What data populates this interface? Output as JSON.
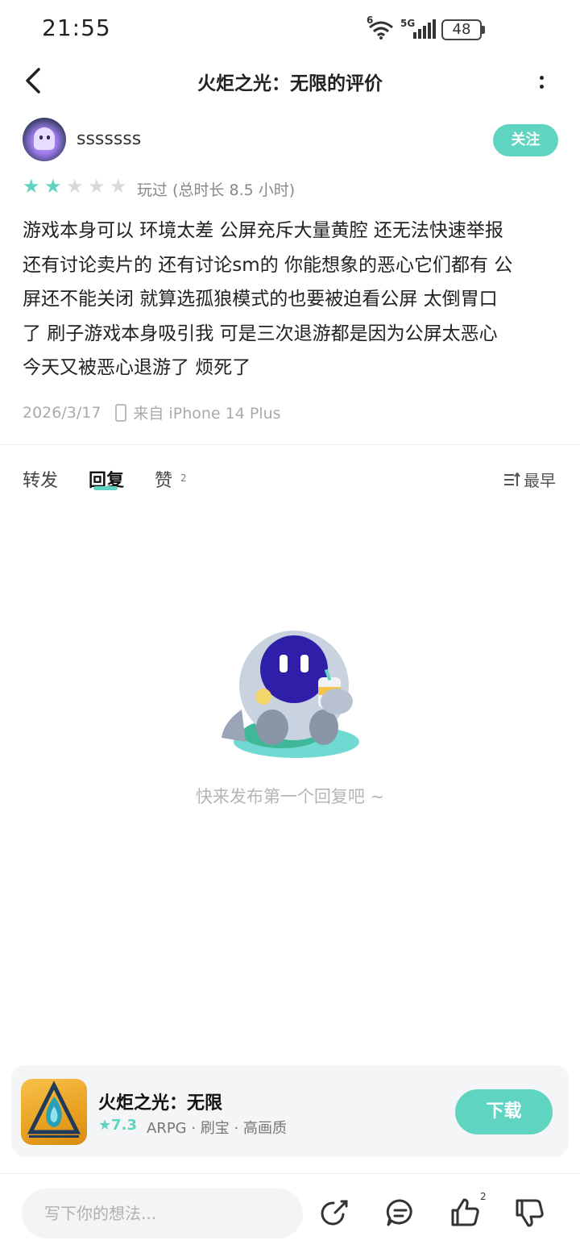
{
  "status_bar": {
    "time": "21:55",
    "battery": "48",
    "wifi_label": "6",
    "net_label": "5G"
  },
  "header": {
    "title": "火炬之光：无限的评价"
  },
  "user": {
    "name": "sssssss",
    "follow_label": "关注"
  },
  "rating": {
    "stars": 2,
    "max": 5,
    "played_text": "玩过 (总时长 8.5 小时)"
  },
  "review": {
    "lines": [
      "游戏本身可以 环境太差 公屏充斥大量黄腔 还无法快速举报",
      "还有讨论卖片的 还有讨论sm的 你能想象的恶心它们都有 公",
      "屏还不能关闭 就算选孤狼模式的也要被迫看公屏 太倒胃口",
      "了 刷子游戏本身吸引我 可是三次退游都是因为公屏太恶心",
      "今天又被恶心退游了 烦死了"
    ],
    "date": "2026/3/17",
    "device": "来自 iPhone 14 Plus"
  },
  "tabs": {
    "repost": "转发",
    "reply": "回复",
    "like": "赞",
    "like_count": "2",
    "sort": "最早"
  },
  "empty_state": {
    "text": "快来发布第一个回复吧 ~"
  },
  "game": {
    "name": "火炬之光：无限",
    "score": "7.3",
    "tags": "ARPG · 刷宝 · 高画质",
    "download_label": "下载"
  },
  "bottom_bar": {
    "placeholder": "写下你的想法...",
    "like_count": "2"
  },
  "colors": {
    "accent": "#5fd4c0",
    "text": "#222222",
    "muted": "#aaaaaa"
  },
  "icons": [
    "back-icon",
    "more-icon",
    "phone-icon",
    "sort-icon",
    "share-icon",
    "comment-icon",
    "thumb-up-icon",
    "thumb-down-icon",
    "wifi-icon",
    "signal-icon",
    "battery-icon"
  ]
}
